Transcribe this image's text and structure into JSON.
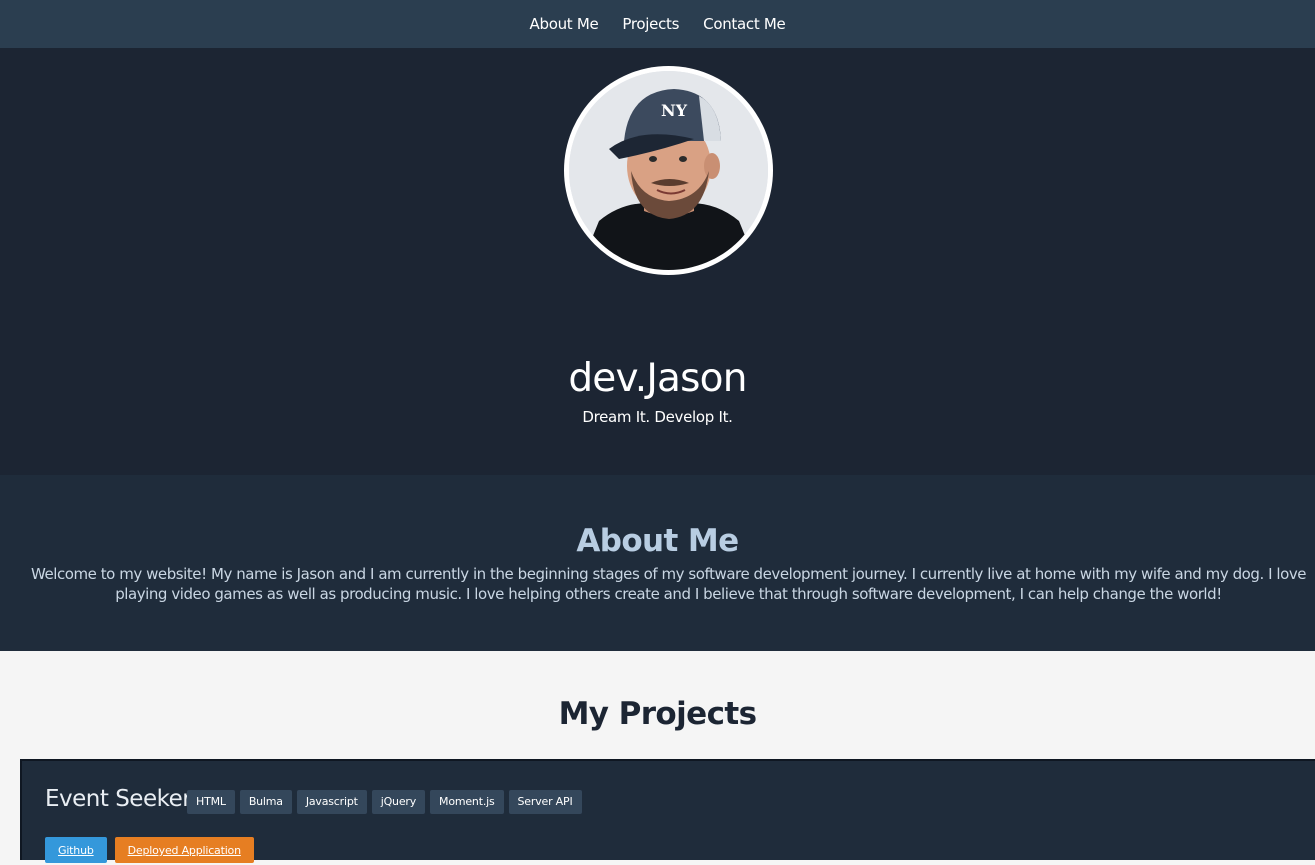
{
  "nav": {
    "items": [
      "About Me",
      "Projects",
      "Contact Me"
    ]
  },
  "hero": {
    "title": "dev.Jason",
    "subtitle": "Dream It. Develop It."
  },
  "about": {
    "title": "About Me",
    "text": "Welcome to my website! My name is Jason and I am currently in the beginning stages of my software development journey. I currently live at home with my wife and my dog. I love playing video games as well as producing music. I love helping others create and I believe that through software development, I can help change the world!"
  },
  "projects": {
    "title": "My Projects",
    "items": [
      {
        "name": "Event Seeker",
        "tags": [
          "HTML",
          "Bulma",
          "Javascript",
          "jQuery",
          "Moment.js",
          "Server API"
        ],
        "github_label": "Github",
        "deploy_label": "Deployed Application"
      }
    ]
  },
  "colors": {
    "nav_bg": "#2b3e50",
    "hero_bg": "#1c2533",
    "about_bg": "#1f2c3b",
    "github": "#3498db",
    "deploy": "#e67e22"
  }
}
